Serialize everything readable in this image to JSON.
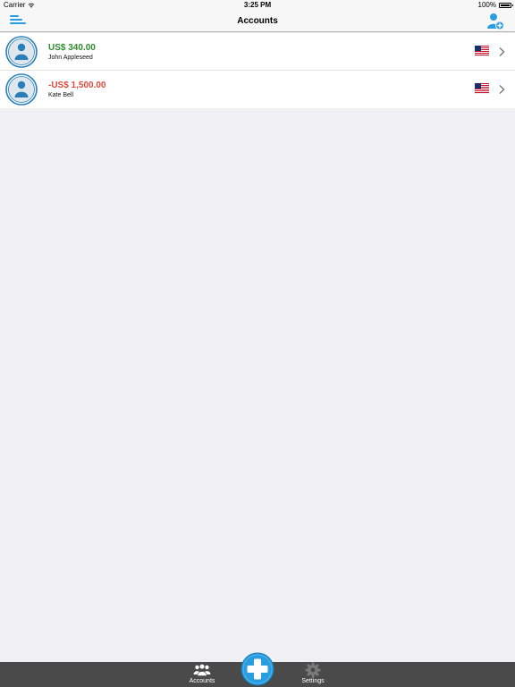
{
  "status_bar": {
    "carrier": "Carrier",
    "time": "3:25 PM",
    "battery": "100%"
  },
  "nav": {
    "title": "Accounts"
  },
  "accounts": [
    {
      "amount": "US$ 340.00",
      "name": "John Appleseed",
      "sign": "positive",
      "flag": "us-flag-icon"
    },
    {
      "amount": "-US$ 1,500.00",
      "name": "Kate Bell",
      "sign": "negative",
      "flag": "us-flag-icon"
    }
  ],
  "tab_bar": {
    "accounts_label": "Accounts",
    "settings_label": "Settings"
  },
  "colors": {
    "accent": "#2a9de0",
    "positive": "#2c8b2c",
    "negative": "#e04a3a",
    "tab_bar": "#4a4a4a"
  }
}
